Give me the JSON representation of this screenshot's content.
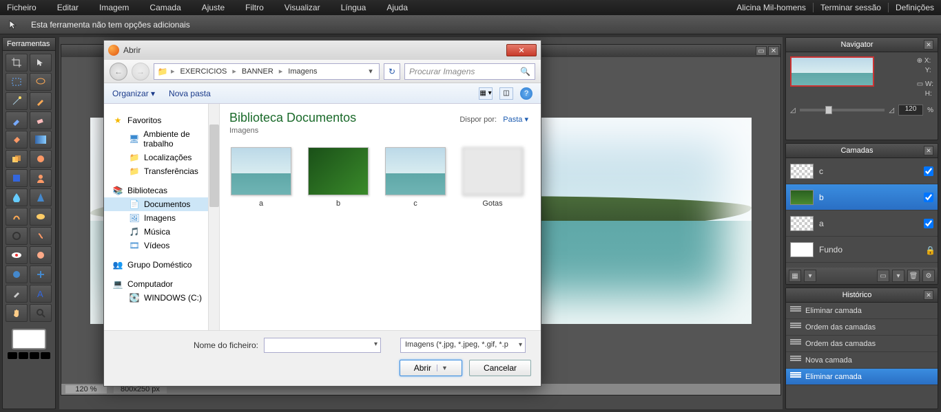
{
  "menubar": {
    "items": [
      "Ficheiro",
      "Editar",
      "Imagem",
      "Camada",
      "Ajuste",
      "Filtro",
      "Visualizar",
      "Língua",
      "Ajuda"
    ],
    "user": "Alicina Mil-homens",
    "logout": "Terminar sessão",
    "settings": "Definições"
  },
  "tool_options": {
    "text": "Esta ferramenta não tem opções adicionais"
  },
  "tools_panel": {
    "title": "Ferramentas"
  },
  "canvas": {
    "zoom": "120 %",
    "dimensions": "800x250 px"
  },
  "navigator": {
    "title": "Navigator",
    "x_label": "X:",
    "y_label": "Y:",
    "w_label": "W:",
    "h_label": "H:",
    "zoom_value": "120",
    "zoom_unit": "%"
  },
  "layers": {
    "title": "Camadas",
    "items": [
      {
        "name": "c",
        "checked": true,
        "thumb": "lake"
      },
      {
        "name": "b",
        "checked": true,
        "thumb": "green",
        "selected": true
      },
      {
        "name": "a",
        "checked": true,
        "thumb": "lake"
      },
      {
        "name": "Fundo",
        "locked": true,
        "thumb": "white"
      }
    ]
  },
  "history": {
    "title": "Histórico",
    "items": [
      {
        "label": "Eliminar camada"
      },
      {
        "label": "Ordem das camadas"
      },
      {
        "label": "Ordem das camadas"
      },
      {
        "label": "Nova camada"
      },
      {
        "label": "Eliminar camada",
        "selected": true
      }
    ]
  },
  "dialog": {
    "title": "Abrir",
    "breadcrumb": [
      "EXERCICIOS",
      "BANNER",
      "Imagens"
    ],
    "search_placeholder": "Procurar Imagens",
    "organizar": "Organizar",
    "nova_pasta": "Nova pasta",
    "library_title": "Biblioteca Documentos",
    "library_sub": "Imagens",
    "arrange_label": "Dispor por:",
    "arrange_value": "Pasta",
    "tree": {
      "favoritos": "Favoritos",
      "ambiente": "Ambiente de trabalho",
      "localizacoes": "Localizações",
      "transferencias": "Transferências",
      "bibliotecas": "Bibliotecas",
      "documentos": "Documentos",
      "imagens": "Imagens",
      "musica": "Música",
      "videos": "Vídeos",
      "grupo": "Grupo Doméstico",
      "computador": "Computador",
      "drive_c": "WINDOWS (C:)"
    },
    "thumbs": [
      {
        "label": "a",
        "type": "lake"
      },
      {
        "label": "b",
        "type": "leaf"
      },
      {
        "label": "c",
        "type": "lake"
      },
      {
        "label": "Gotas",
        "type": "blur"
      }
    ],
    "file_label": "Nome do ficheiro:",
    "type_filter": "Imagens (*.jpg, *.jpeg, *.gif, *.p",
    "open_btn": "Abrir",
    "cancel_btn": "Cancelar"
  }
}
